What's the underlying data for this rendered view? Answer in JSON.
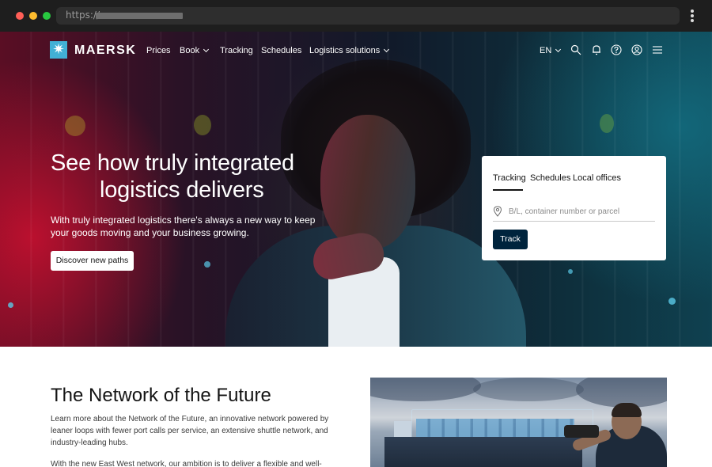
{
  "browser": {
    "url_prefix": "https://"
  },
  "nav": {
    "brand": "MAERSK",
    "items": [
      "Prices",
      "Book",
      "Tracking",
      "Schedules",
      "Logistics solutions"
    ],
    "language": "EN",
    "icons": [
      "search-icon",
      "bell-icon",
      "help-icon",
      "user-icon",
      "menu-icon"
    ]
  },
  "hero": {
    "title_line1": "See how truly integrated",
    "title_line2": "logistics delivers",
    "subtitle": "With truly integrated logistics there's always a new way to keep your goods moving and your business growing.",
    "cta": "Discover new paths"
  },
  "tracking": {
    "tabs": [
      "Tracking",
      "Schedules",
      "Local offices"
    ],
    "placeholder": "B/L, container number or parcel",
    "button": "Track"
  },
  "network": {
    "title": "The Network of the Future",
    "paragraph1": "Learn more about the Network of the Future, an innovative network powered by leaner loops with fewer port calls per service, an extensive shuttle network, and industry-leading hubs.",
    "paragraph2": "With the new East West network, our ambition is to deliver a flexible and well-"
  },
  "colors": {
    "brand": "#42b0d5",
    "track_button": "#00243d"
  }
}
